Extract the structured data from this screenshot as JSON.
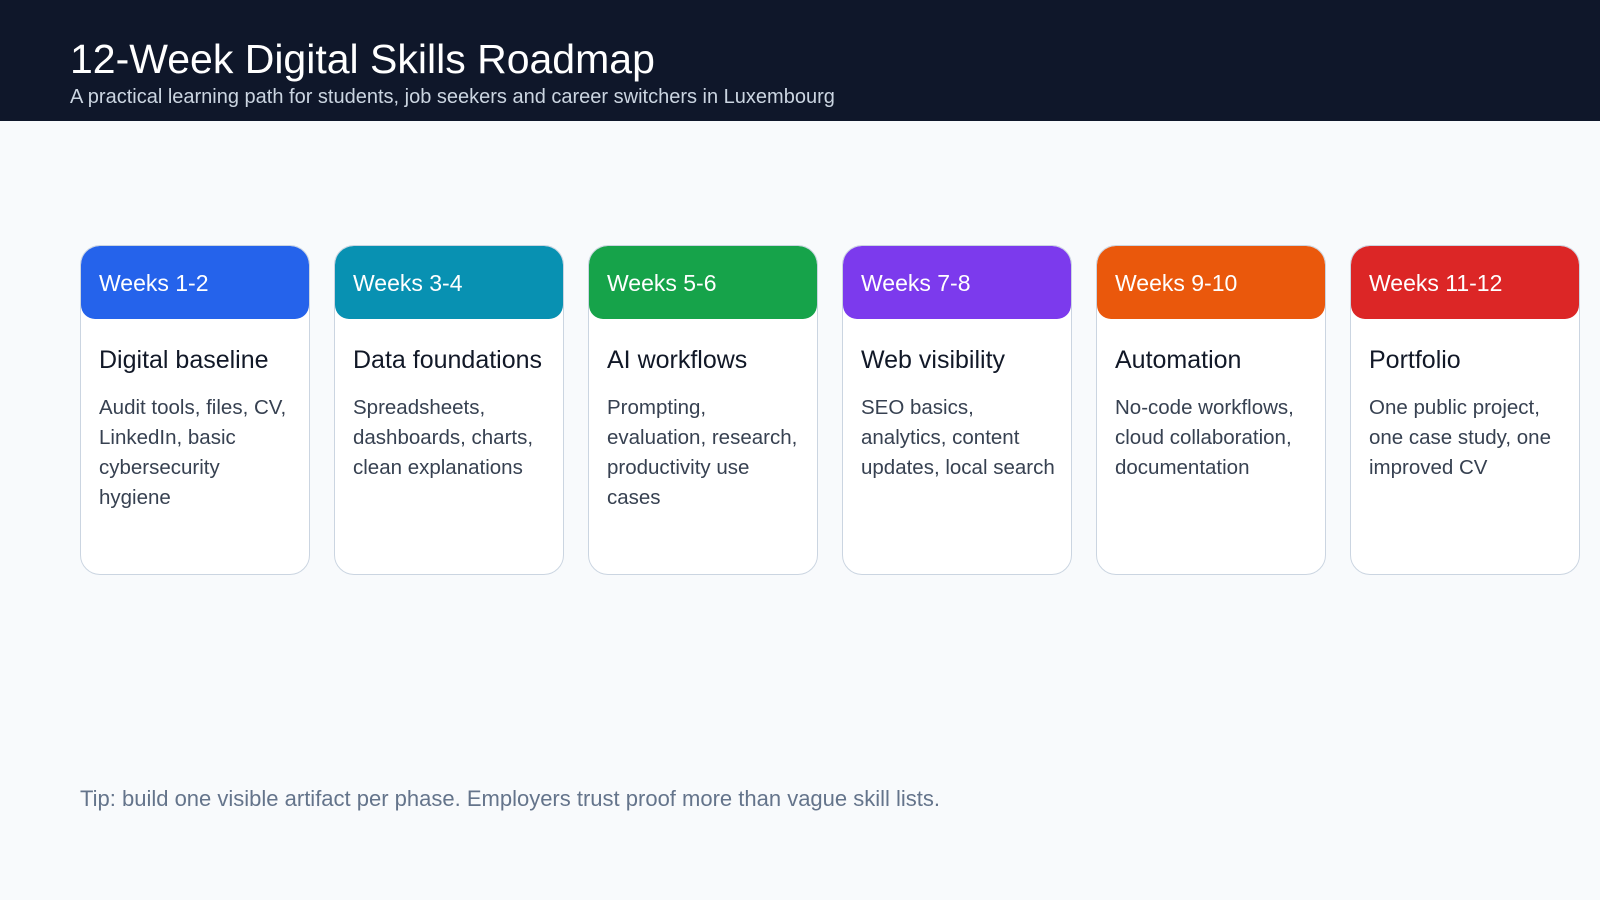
{
  "header": {
    "title": "12-Week Digital Skills Roadmap",
    "subtitle": "A practical learning path for students, job seekers and career switchers in Luxembourg"
  },
  "phases": [
    {
      "weeks": "Weeks 1-2",
      "title": "Digital baseline",
      "desc": "Audit tools, files, CV, LinkedIn, basic cybersecurity hygiene",
      "color": "#2563eb"
    },
    {
      "weeks": "Weeks 3-4",
      "title": "Data foundations",
      "desc": "Spreadsheets, dashboards, charts, clean explanations",
      "color": "#0891b2"
    },
    {
      "weeks": "Weeks 5-6",
      "title": "AI workflows",
      "desc": "Prompting, evaluation, research, productivity use cases",
      "color": "#16a34a"
    },
    {
      "weeks": "Weeks 7-8",
      "title": "Web visibility",
      "desc": "SEO basics, analytics, content updates, local search",
      "color": "#7c3aed"
    },
    {
      "weeks": "Weeks 9-10",
      "title": "Automation",
      "desc": "No-code workflows, cloud collaboration, documentation",
      "color": "#ea580c"
    },
    {
      "weeks": "Weeks 11-12",
      "title": "Portfolio",
      "desc": "One public project, one case study, one improved CV",
      "color": "#dc2626"
    }
  ],
  "footer": {
    "tip": "Tip: build one visible artifact per phase. Employers trust proof more than vague skill lists."
  }
}
